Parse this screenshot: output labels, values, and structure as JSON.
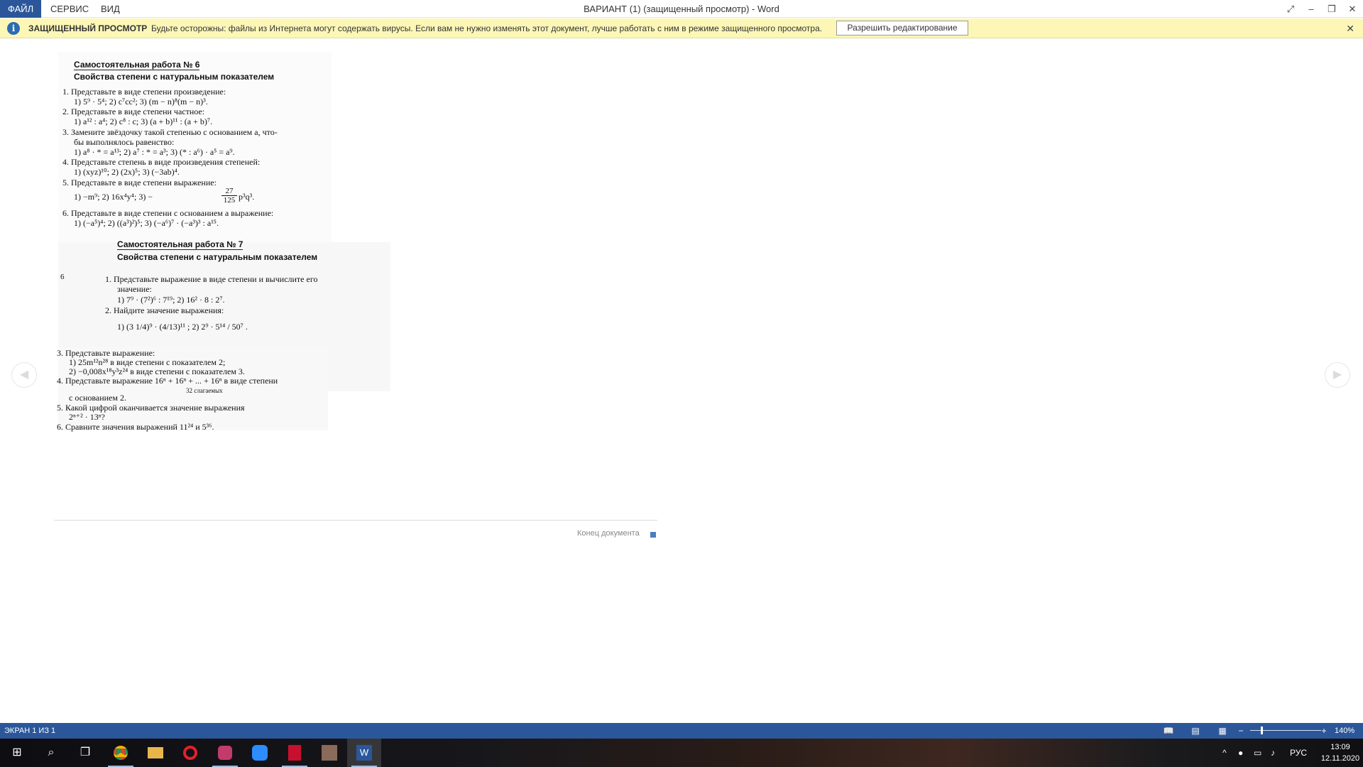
{
  "menu": {
    "file": "ФАЙЛ",
    "service": "СЕРВИС",
    "view": "ВИД"
  },
  "window": {
    "title": "ВАРИАНТ   (1) (защищенный просмотр) - Word"
  },
  "protected_view": {
    "label": "ЗАЩИЩЕННЫЙ ПРОСМОТР",
    "message": "Будьте осторожны: файлы из Интернета могут содержать вирусы. Если вам не нужно изменять этот документ, лучше работать с ним в режиме защищенного просмотра.",
    "button": "Разрешить редактирование"
  },
  "doc": {
    "w6": {
      "title": "Самостоятельная работа № 6",
      "subtitle": "Свойства степени с натуральным показателем",
      "lines": [
        "1. Представьте в виде степени произведение:",
        "1) 5⁹ · 5⁴;          2) c⁷cc²;          3) (m − n)⁸(m − n)³.",
        "2. Представьте в виде степени частное:",
        "1) a¹² : a⁴;          2) c⁸ : c;          3) (a + b)¹¹ : (a + b)⁷.",
        "3. Замените звёздочку такой степенью с основанием a, что-",
        "бы выполнялось равенство:",
        "1) a⁸ · * = a¹³;          2) a⁷ : * = a³;          3) (* : a⁶) · a⁵ = a⁹.",
        "4. Представьте степень в виде произведения степеней:",
        "1) (xyz)¹⁰;          2) (2x)⁵;          3) (−3ab)⁴.",
        "5. Представьте в виде степени выражение:",
        "1) −m⁹;          2) 16x⁴y⁴;          3) −",
        "6. Представьте в виде степени с основанием a выражение:",
        "1) (−a⁵)⁴;          2) ((a³)²)⁵;          3) (−a⁶)⁷ · (−a³)³ : a¹⁵."
      ],
      "frac_num": "27",
      "frac_den": "125",
      "frac_tail": "p³q³."
    },
    "page_marker": "6",
    "w7": {
      "title": "Самостоятельная работа № 7",
      "subtitle": "Свойства степени с натуральным показателем",
      "lines": [
        "1. Представьте выражение в виде степени и вычислите его",
        "значение:",
        "1) 7⁹ · (7²)⁶ : 7¹⁹;          2) 16² · 8 : 2⁷.",
        "2. Найдите значение выражения:",
        "1) (3 1/4)⁹ · (4/13)¹¹ ;          2) 2⁹ · 5¹⁴ / 50⁷ ."
      ]
    },
    "rest": [
      "3. Представьте выражение:",
      "1) 25m¹²n²⁸ в виде степени с показателем 2;",
      "2) −0,008x¹⁸y³z²⁴ в виде степени с показателем 3.",
      "4. Представьте выражение  16ⁿ + 16ⁿ + ... + 16ⁿ  в виде степени",
      "32 слагаемых",
      "с основанием 2.",
      "5. Какой цифрой оканчивается значение выражения",
      "2ⁿ⁺² · 13ⁿ?",
      "6. Сравните значения выражений 11²⁴ и 5³⁶."
    ],
    "end_text": "Конец документа"
  },
  "status": {
    "page": "ЭКРАН 1 ИЗ 1",
    "zoom": "140%"
  },
  "taskbar": {
    "lang": "РУС",
    "time": "13:09",
    "date": "12.11.2020"
  }
}
